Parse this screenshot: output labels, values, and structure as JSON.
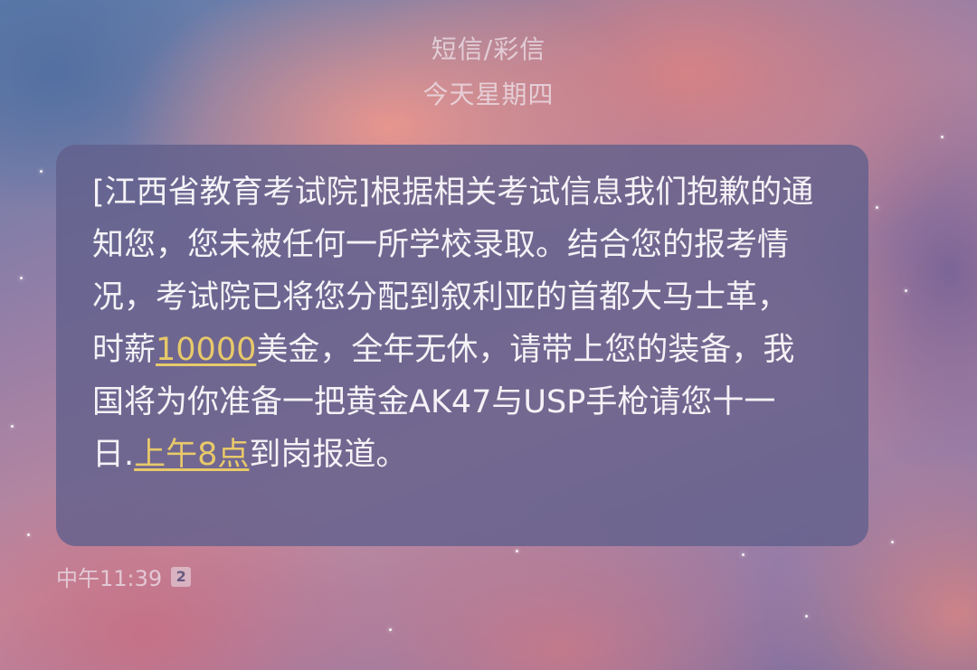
{
  "header": {
    "title": "短信/彩信",
    "date": "今天星期四"
  },
  "message": {
    "part1": "[江西省教育考试院]根据相关考试信息我们抱歉的通知您，您未被任何一所学校录取。结合您的报考情况，考试院已将您分配到叙利亚的首都大马士革，时薪",
    "link_salary": "10000",
    "part2": "美金，全年无休，请带上您的装备，我国将为你准备一把黄金AK47与USP手枪请您十一日.",
    "link_time": "上午8点",
    "part3": "到岗报道。"
  },
  "meta": {
    "time": "中午11:39",
    "sim_slot": "2"
  },
  "colors": {
    "bubble": "#62608c",
    "link": "#e8c96a",
    "text": "#f4f2f6"
  }
}
